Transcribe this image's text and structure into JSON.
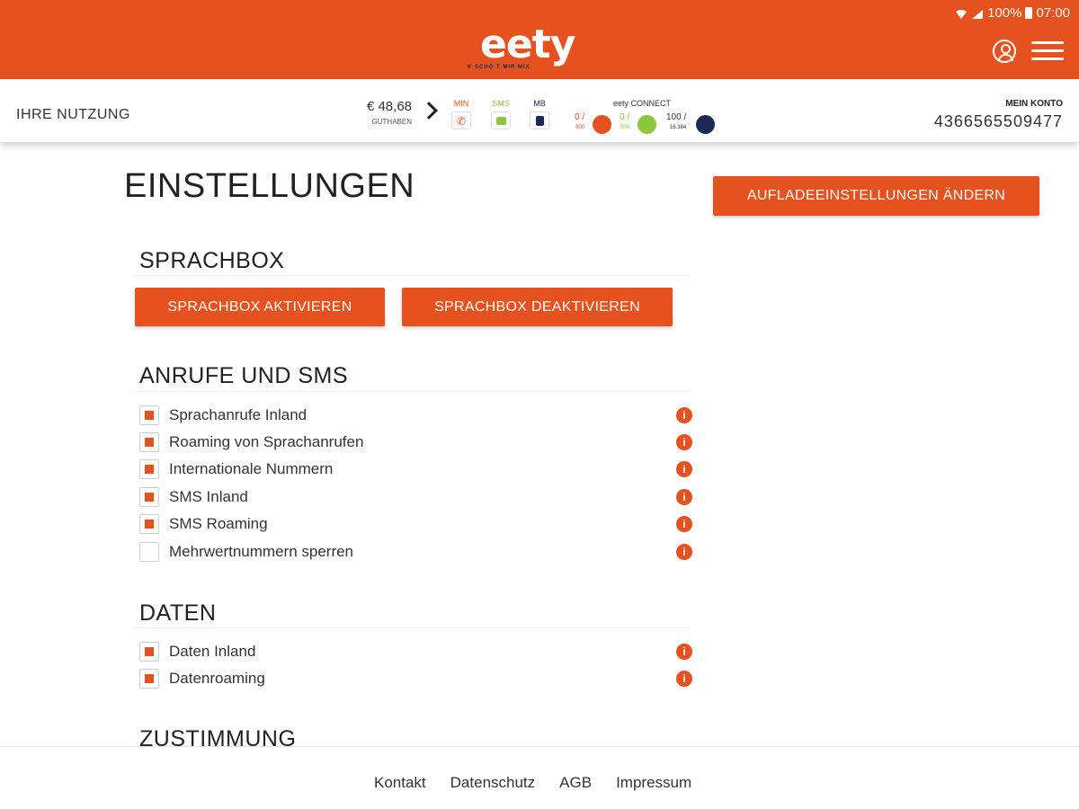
{
  "status": {
    "battery": "100%",
    "time": "07:00"
  },
  "brand": {
    "logo": "eety",
    "tagline": "K SCHO T MIR MIX"
  },
  "usage": {
    "label": "IHRE NUTZUNG",
    "balance": "€ 48,68",
    "balance_label": "GUTHABEN",
    "units": [
      {
        "label": "MIN",
        "icon": "phone-icon",
        "color": "#e5511f"
      },
      {
        "label": "SMS",
        "icon": "chat-icon",
        "color": "#8dc63f"
      },
      {
        "label": "MB",
        "icon": "data-icon",
        "color": "#1a2a55"
      }
    ],
    "connect_title": "eety CONNECT",
    "counters": [
      {
        "value": "0 /",
        "sub": "800",
        "color": "#e5511f"
      },
      {
        "value": "0 /",
        "sub": "500",
        "color": "#8dc63f"
      },
      {
        "value": "100 /",
        "sub": "16.384",
        "color": "#1a2a55"
      }
    ],
    "account_label": "MEIN KONTO",
    "account_number": "4366565509477"
  },
  "page": {
    "title": "EINSTELLUNGEN",
    "topup_button": "AUFLADEEINSTELLUNGEN ÄNDERN"
  },
  "sprachbox": {
    "title": "SPRACHBOX",
    "activate": "SPRACHBOX AKTIVIEREN",
    "deactivate": "SPRACHBOX DEAKTIVIEREN"
  },
  "calls": {
    "title": "ANRUFE UND SMS",
    "options": [
      {
        "label": "Sprachanrufe Inland",
        "checked": true
      },
      {
        "label": "Roaming von Sprachanrufen",
        "checked": true
      },
      {
        "label": "Internationale Nummern",
        "checked": true
      },
      {
        "label": "SMS Inland",
        "checked": true
      },
      {
        "label": "SMS Roaming",
        "checked": true
      },
      {
        "label": "Mehrwertnummern sperren",
        "checked": false
      }
    ]
  },
  "data_section": {
    "title": "DATEN",
    "options": [
      {
        "label": "Daten Inland",
        "checked": true
      },
      {
        "label": "Datenroaming",
        "checked": true
      }
    ]
  },
  "consent": {
    "title": "ZUSTIMMUNG"
  },
  "footer": {
    "links": [
      "Kontakt",
      "Datenschutz",
      "AGB",
      "Impressum"
    ]
  },
  "colors": {
    "accent": "#e5511f",
    "green": "#8dc63f",
    "navy": "#1a2a55"
  }
}
